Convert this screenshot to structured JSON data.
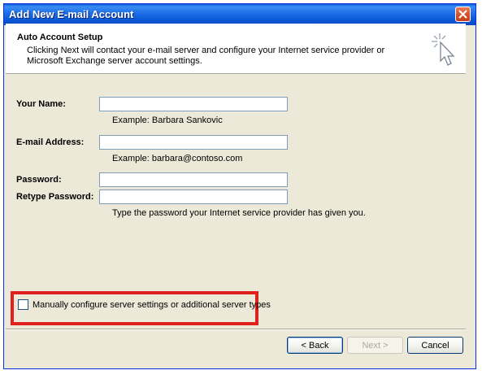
{
  "window": {
    "title": "Add New E-mail Account"
  },
  "header": {
    "title": "Auto Account Setup",
    "description": "Clicking Next will contact your e-mail server and configure your Internet service provider or Microsoft Exchange server account settings."
  },
  "form": {
    "name_label": "Your Name:",
    "name_value": "",
    "name_hint": "Example: Barbara Sankovic",
    "email_label": "E-mail Address:",
    "email_value": "",
    "email_hint": "Example: barbara@contoso.com",
    "password_label": "Password:",
    "password_value": "",
    "retype_label": "Retype Password:",
    "retype_value": "",
    "password_hint": "Type the password your Internet service provider has given you."
  },
  "manual_config": {
    "label": "Manually configure server settings or additional server types",
    "checked": false
  },
  "buttons": {
    "back": "< Back",
    "next": "Next >",
    "cancel": "Cancel"
  },
  "colors": {
    "highlight": "#e0201f",
    "titlebar": "#0854d4",
    "dialog_bg": "#ece9d8"
  },
  "icons": {
    "close": "close-icon",
    "wizard": "cursor-sparkle-icon"
  }
}
